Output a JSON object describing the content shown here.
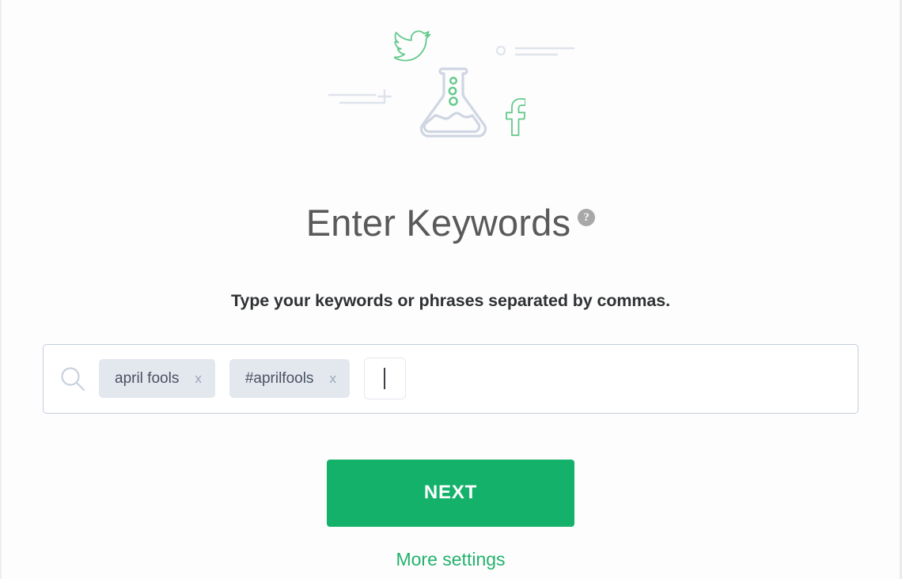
{
  "illustration": {
    "items": [
      {
        "name": "twitter-bird-icon",
        "color": "#63c98c"
      },
      {
        "name": "facebook-f-icon",
        "color": "#63c98c"
      },
      {
        "name": "flask-icon",
        "color": "#cfd6e2",
        "accent": "#63c98c"
      },
      {
        "name": "feed-lines-icon",
        "color": "#dfe4ec"
      },
      {
        "name": "plus-lines-icon",
        "color": "#dfe4ec"
      }
    ]
  },
  "header": {
    "title": "Enter Keywords",
    "help_icon_glyph": "?",
    "subtitle": "Type your keywords or phrases separated by commas."
  },
  "search": {
    "icon": "search-icon",
    "placeholder": "",
    "current_input_value": "",
    "tags": [
      {
        "label": "april fools",
        "remove_label": "x"
      },
      {
        "label": "#aprilfools",
        "remove_label": "x"
      }
    ]
  },
  "actions": {
    "next_label": "NEXT",
    "more_settings_label": "More settings"
  },
  "colors": {
    "brand_green": "#14b16b",
    "link_green": "#23b26d",
    "tag_background": "#e3e8ef",
    "tag_text": "#4a5262",
    "border_blue_gray": "#c5cedd",
    "page_background": "#fdfdfd",
    "title_gray": "#5a5a5a",
    "subtitle_dark": "#2f3234",
    "help_icon_gray": "#a8a8a8"
  }
}
